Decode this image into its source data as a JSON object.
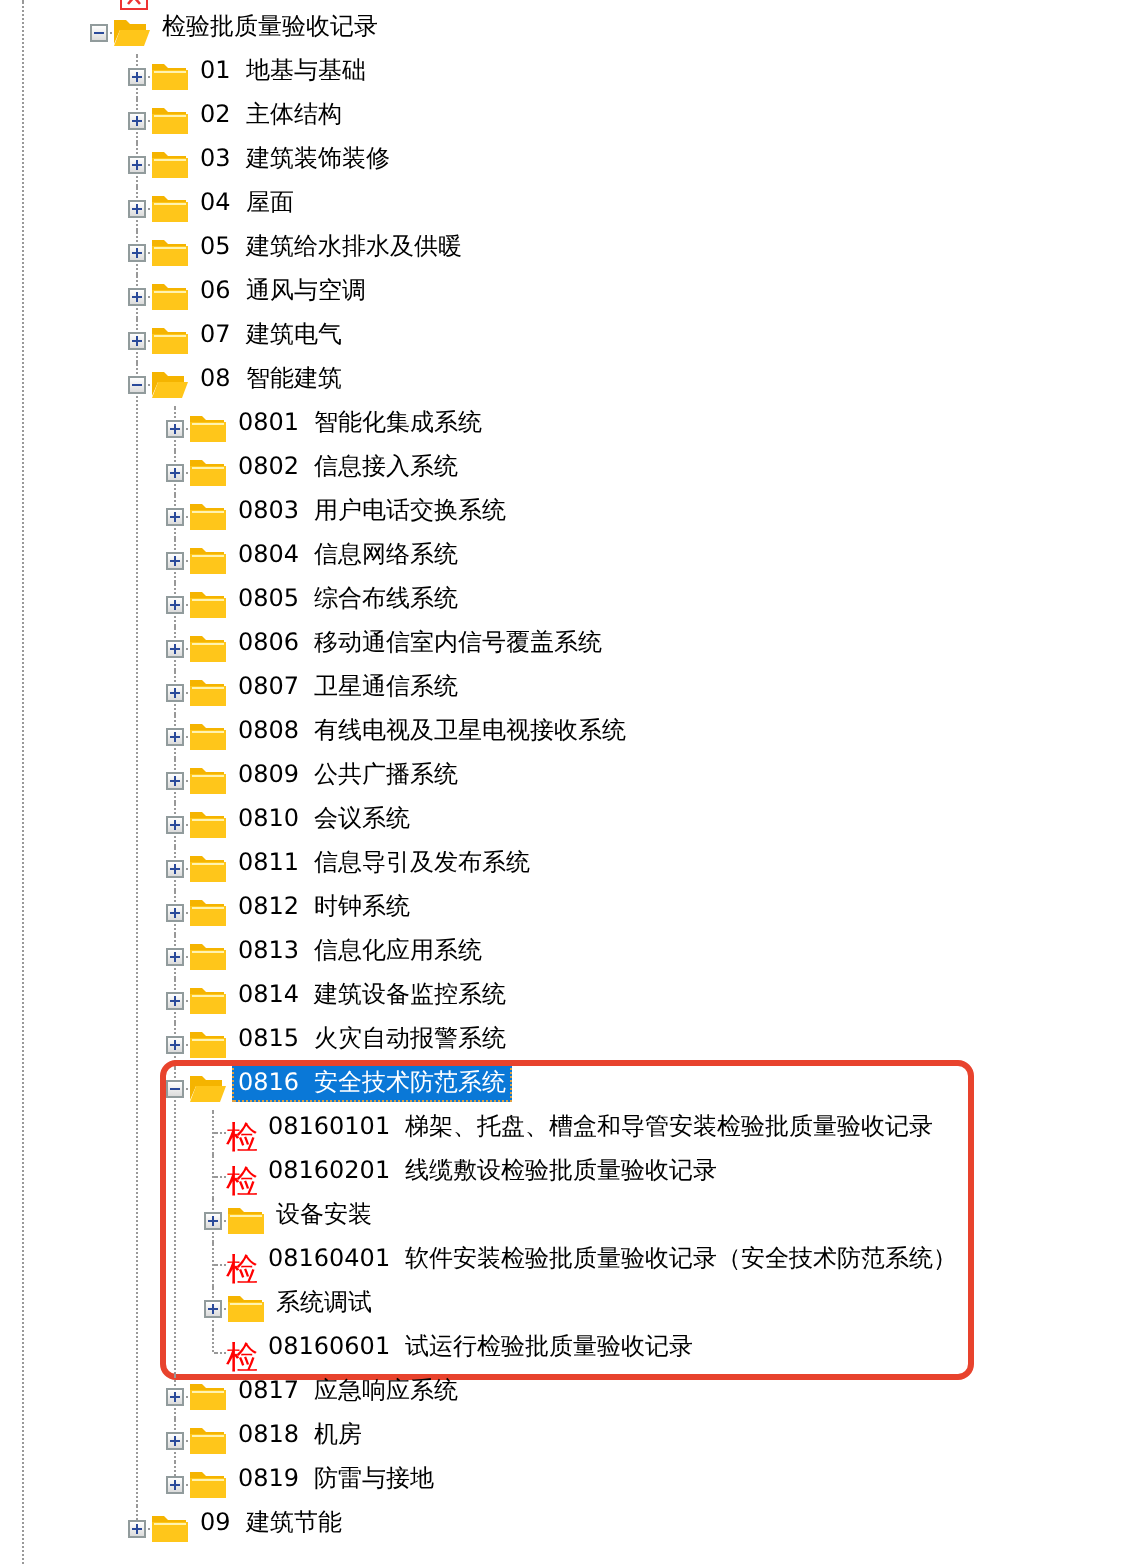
{
  "tree": [
    {
      "label": "检验批质量验收记录",
      "kind": "folder",
      "expanded": true,
      "selected": false,
      "children": [
        {
          "label": "01  地基与基础",
          "kind": "folder",
          "expanded": false,
          "selected": false
        },
        {
          "label": "02  主体结构",
          "kind": "folder",
          "expanded": false,
          "selected": false
        },
        {
          "label": "03  建筑装饰装修",
          "kind": "folder",
          "expanded": false,
          "selected": false
        },
        {
          "label": "04  屋面",
          "kind": "folder",
          "expanded": false,
          "selected": false
        },
        {
          "label": "05  建筑给水排水及供暖",
          "kind": "folder",
          "expanded": false,
          "selected": false
        },
        {
          "label": "06  通风与空调",
          "kind": "folder",
          "expanded": false,
          "selected": false
        },
        {
          "label": "07  建筑电气",
          "kind": "folder",
          "expanded": false,
          "selected": false
        },
        {
          "label": "08  智能建筑",
          "kind": "folder",
          "expanded": true,
          "selected": false,
          "children": [
            {
              "label": "0801  智能化集成系统",
              "kind": "folder",
              "expanded": false,
              "selected": false
            },
            {
              "label": "0802  信息接入系统",
              "kind": "folder",
              "expanded": false,
              "selected": false
            },
            {
              "label": "0803  用户电话交换系统",
              "kind": "folder",
              "expanded": false,
              "selected": false
            },
            {
              "label": "0804  信息网络系统",
              "kind": "folder",
              "expanded": false,
              "selected": false
            },
            {
              "label": "0805  综合布线系统",
              "kind": "folder",
              "expanded": false,
              "selected": false
            },
            {
              "label": "0806  移动通信室内信号覆盖系统",
              "kind": "folder",
              "expanded": false,
              "selected": false
            },
            {
              "label": "0807  卫星通信系统",
              "kind": "folder",
              "expanded": false,
              "selected": false
            },
            {
              "label": "0808  有线电视及卫星电视接收系统",
              "kind": "folder",
              "expanded": false,
              "selected": false
            },
            {
              "label": "0809  公共广播系统",
              "kind": "folder",
              "expanded": false,
              "selected": false
            },
            {
              "label": "0810  会议系统",
              "kind": "folder",
              "expanded": false,
              "selected": false
            },
            {
              "label": "0811  信息导引及发布系统",
              "kind": "folder",
              "expanded": false,
              "selected": false
            },
            {
              "label": "0812  时钟系统",
              "kind": "folder",
              "expanded": false,
              "selected": false
            },
            {
              "label": "0813  信息化应用系统",
              "kind": "folder",
              "expanded": false,
              "selected": false
            },
            {
              "label": "0814  建筑设备监控系统",
              "kind": "folder",
              "expanded": false,
              "selected": false
            },
            {
              "label": "0815  火灾自动报警系统",
              "kind": "folder",
              "expanded": false,
              "selected": false
            },
            {
              "label": "0816  安全技术防范系统",
              "kind": "folder",
              "expanded": true,
              "selected": true,
              "outlined": true,
              "children": [
                {
                  "label": "08160101  梯架、托盘、槽盒和导管安装检验批质量验收记录",
                  "kind": "record",
                  "badge": "检",
                  "selected": false
                },
                {
                  "label": "08160201  线缆敷设检验批质量验收记录",
                  "kind": "record",
                  "badge": "检",
                  "selected": false
                },
                {
                  "label": "设备安装",
                  "kind": "folder",
                  "expanded": false,
                  "selected": false
                },
                {
                  "label": "08160401  软件安装检验批质量验收记录（安全技术防范系统）",
                  "kind": "record",
                  "badge": "检",
                  "selected": false
                },
                {
                  "label": "系统调试",
                  "kind": "folder",
                  "expanded": false,
                  "selected": false
                },
                {
                  "label": "08160601  试运行检验批质量验收记录",
                  "kind": "record",
                  "badge": "检",
                  "selected": false
                }
              ]
            },
            {
              "label": "0817  应急响应系统",
              "kind": "folder",
              "expanded": false,
              "selected": false
            },
            {
              "label": "0818  机房",
              "kind": "folder",
              "expanded": false,
              "selected": false
            },
            {
              "label": "0819  防雷与接地",
              "kind": "folder",
              "expanded": false,
              "selected": false
            }
          ]
        },
        {
          "label": "09  建筑节能",
          "kind": "folder",
          "expanded": false,
          "selected": false
        }
      ]
    }
  ]
}
